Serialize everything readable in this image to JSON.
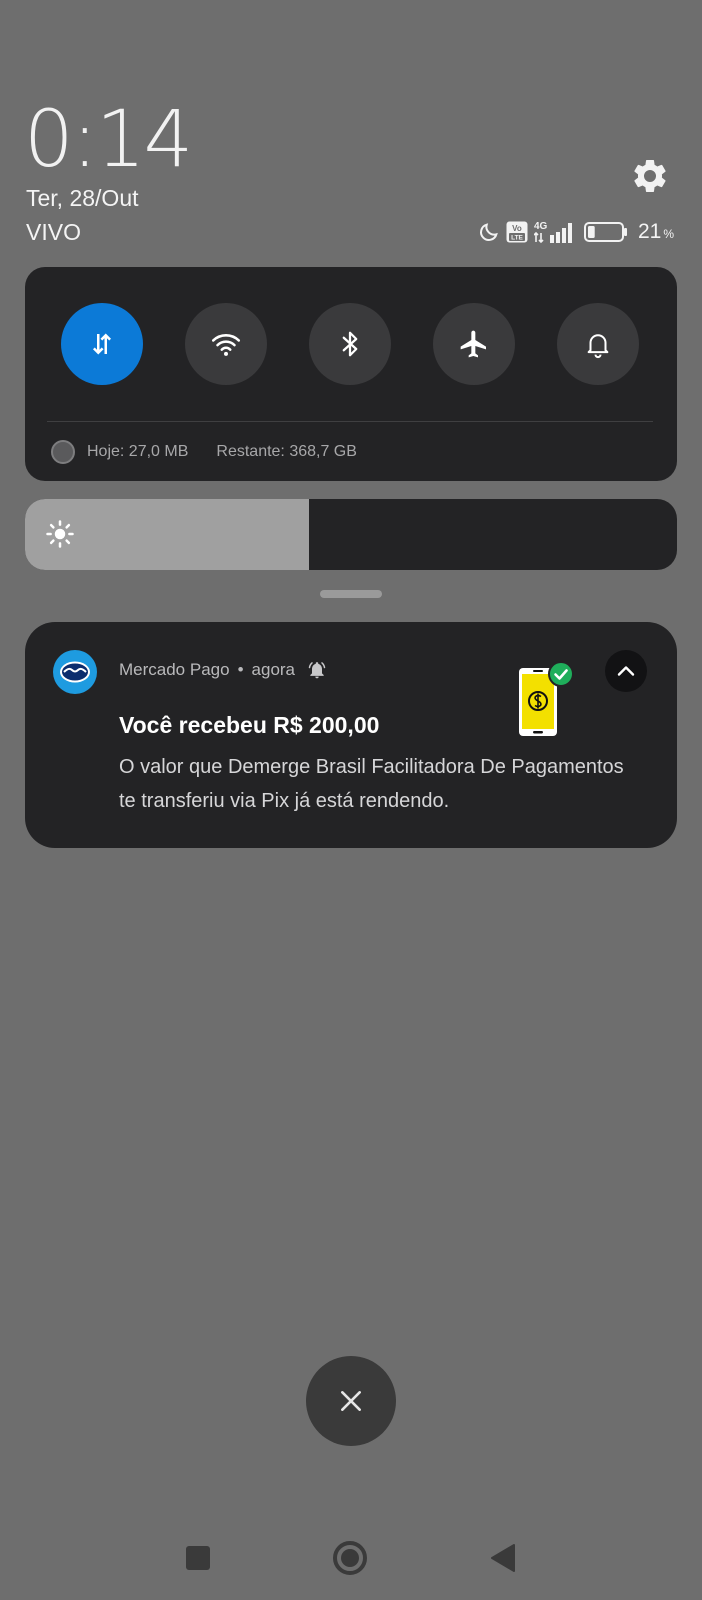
{
  "header": {
    "time": "0:14",
    "date": "Ter, 28/Out",
    "carrier": "VIVO",
    "settings_icon": "gear-icon"
  },
  "status_bar": {
    "icons": [
      "do-not-disturb-moon-icon",
      "volte-icon",
      "4g-signal-icon",
      "battery-icon"
    ],
    "volte_label_top": "Vo",
    "volte_label_bottom": "LTE",
    "network_label": "4G",
    "battery_level": 0.21,
    "battery_percent": "21",
    "battery_percent_unit": "%"
  },
  "quick_settings": {
    "tiles": [
      {
        "name": "mobile-data",
        "icon": "data-arrows-icon",
        "active": true
      },
      {
        "name": "wifi",
        "icon": "wifi-icon",
        "active": false
      },
      {
        "name": "bluetooth",
        "icon": "bluetooth-icon",
        "active": false
      },
      {
        "name": "airplane-mode",
        "icon": "airplane-icon",
        "active": false
      },
      {
        "name": "sound",
        "icon": "bell-icon",
        "active": false
      }
    ],
    "data_usage_today": "Hoje: 27,0 MB",
    "data_remaining": "Restante: 368,7 GB"
  },
  "brightness": {
    "icon": "sun-icon",
    "level": 0.435
  },
  "notification": {
    "app_name": "Mercado Pago",
    "separator": "•",
    "time": "agora",
    "alert_icon": "bell-ringing-icon",
    "title": "Você recebeu R$ 200,00",
    "body": "O valor que Demerge Brasil Facilitadora De Pagamentos te transferiu via Pix já está rendendo.",
    "image": "phone-money-check-icon",
    "expand_icon": "chevron-up-icon"
  },
  "clear_all_icon": "close-icon",
  "navigation": {
    "recents_icon": "square-icon",
    "home_icon": "circle-icon",
    "back_icon": "triangle-back-icon"
  },
  "colors": {
    "background": "#6e6e6e",
    "panel": "#232325",
    "tile_inactive": "#3a3a3c",
    "tile_active": "#0c7ad7",
    "brand": "#1e9be0",
    "check_green": "#1fae5b",
    "coin_yellow": "#f3e000"
  }
}
